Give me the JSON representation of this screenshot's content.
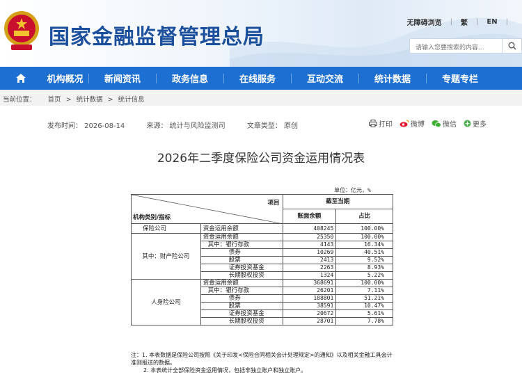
{
  "header": {
    "site_title": "国家金融监督管理总局",
    "links": [
      "无障碍浏览",
      "繁",
      "EN"
    ],
    "search_placeholder": "请输入您要搜索的内容..."
  },
  "nav": {
    "items": [
      "机构概况",
      "新闻资讯",
      "政务信息",
      "在线服务",
      "互动交流",
      "统计数据",
      "专题专栏"
    ]
  },
  "breadcrumb": {
    "label": "当前位置：",
    "items": [
      "首页",
      "统计数据",
      "统计信息"
    ]
  },
  "meta": {
    "publish_time": "发布时间：  2026-08-14",
    "source": "来源：  统计与风险监测司",
    "doc_type": "文章类型：  原创"
  },
  "share": {
    "print": "打印",
    "weibo": "微博",
    "wechat": "微信",
    "more": "更多"
  },
  "doc_title": "2026年二季度保险公司资金运用情况表",
  "table": {
    "unit": "单位：亿元，%",
    "header_item": "项目",
    "header_category": "机构类别/指标",
    "header_period": "截至当期",
    "col_balance": "账面余额",
    "col_share": "占比",
    "insurer": {
      "category": "保险公司",
      "label": "资金运用余额",
      "value": "408245",
      "share": "100.00%"
    },
    "property": {
      "category": "其中：财产险公司",
      "rows": [
        {
          "label": "资金运用余额",
          "value": "25350",
          "share": "100.00%"
        },
        {
          "label": "其中：银行存款",
          "value": "4143",
          "share": "16.34%"
        },
        {
          "label": "债券",
          "value": "10269",
          "share": "40.51%"
        },
        {
          "label": "股票",
          "value": "2413",
          "share": "9.52%"
        },
        {
          "label": "证券投资基金",
          "value": "2263",
          "share": "8.93%"
        },
        {
          "label": "长期股权投资",
          "value": "1324",
          "share": "5.22%"
        }
      ]
    },
    "life": {
      "category": "人身险公司",
      "rows": [
        {
          "label": "资金运用余额",
          "value": "368691",
          "share": "100.00%"
        },
        {
          "label": "其中：银行存款",
          "value": "26201",
          "share": "7.11%"
        },
        {
          "label": "债券",
          "value": "188801",
          "share": "51.21%"
        },
        {
          "label": "股票",
          "value": "38591",
          "share": "10.47%"
        },
        {
          "label": "证券投资基金",
          "value": "20672",
          "share": "5.61%"
        },
        {
          "label": "长期股权投资",
          "value": "28701",
          "share": "7.78%"
        }
      ]
    },
    "notes": [
      "注：1. 本表数据是保险公司按照《关于印发<保险合同相关会计处理规定>的通知》以及相关金融工具会计准则报送的数据。",
      "2. 本表统计全部保险资金运用情况，包括非独立账户和独立账户。"
    ]
  }
}
